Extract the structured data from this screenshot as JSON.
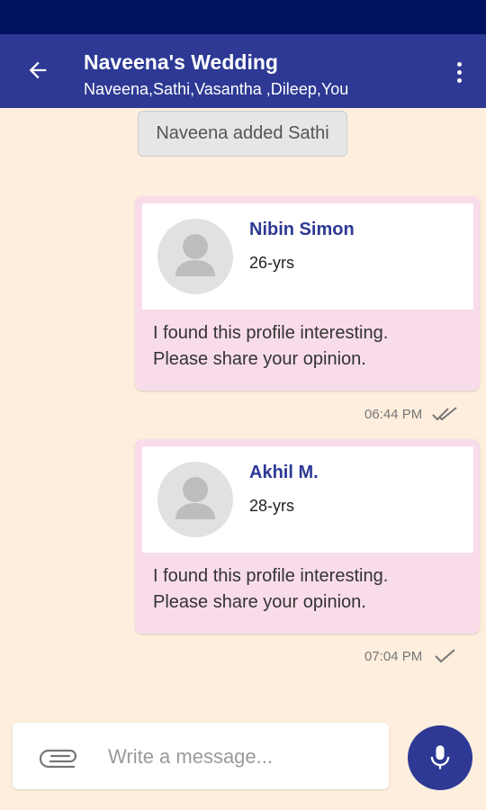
{
  "header": {
    "title": "Naveena's Wedding",
    "members": "Naveena,Sathi,Vasantha ,Dileep,You"
  },
  "system_message": "Naveena added Sathi",
  "messages": [
    {
      "profile_name": "Nibin Simon",
      "profile_age": "26-yrs",
      "text_line1": "I found this profile interesting.",
      "text_line2": "Please share your opinion.",
      "time": "06:44 PM",
      "status": "double-check-icon"
    },
    {
      "profile_name": "Akhil M.",
      "profile_age": "28-yrs",
      "text_line1": "I found this profile interesting.",
      "text_line2": "Please share your opinion.",
      "time": "07:04 PM",
      "status": "single-check-icon"
    }
  ],
  "composer": {
    "placeholder": "Write a message..."
  },
  "colors": {
    "status_bar": "#00115e",
    "app_bar": "#2d3994",
    "background": "#fdeedd",
    "bubble": "#f9dcea",
    "accent_text": "#2d3994"
  }
}
